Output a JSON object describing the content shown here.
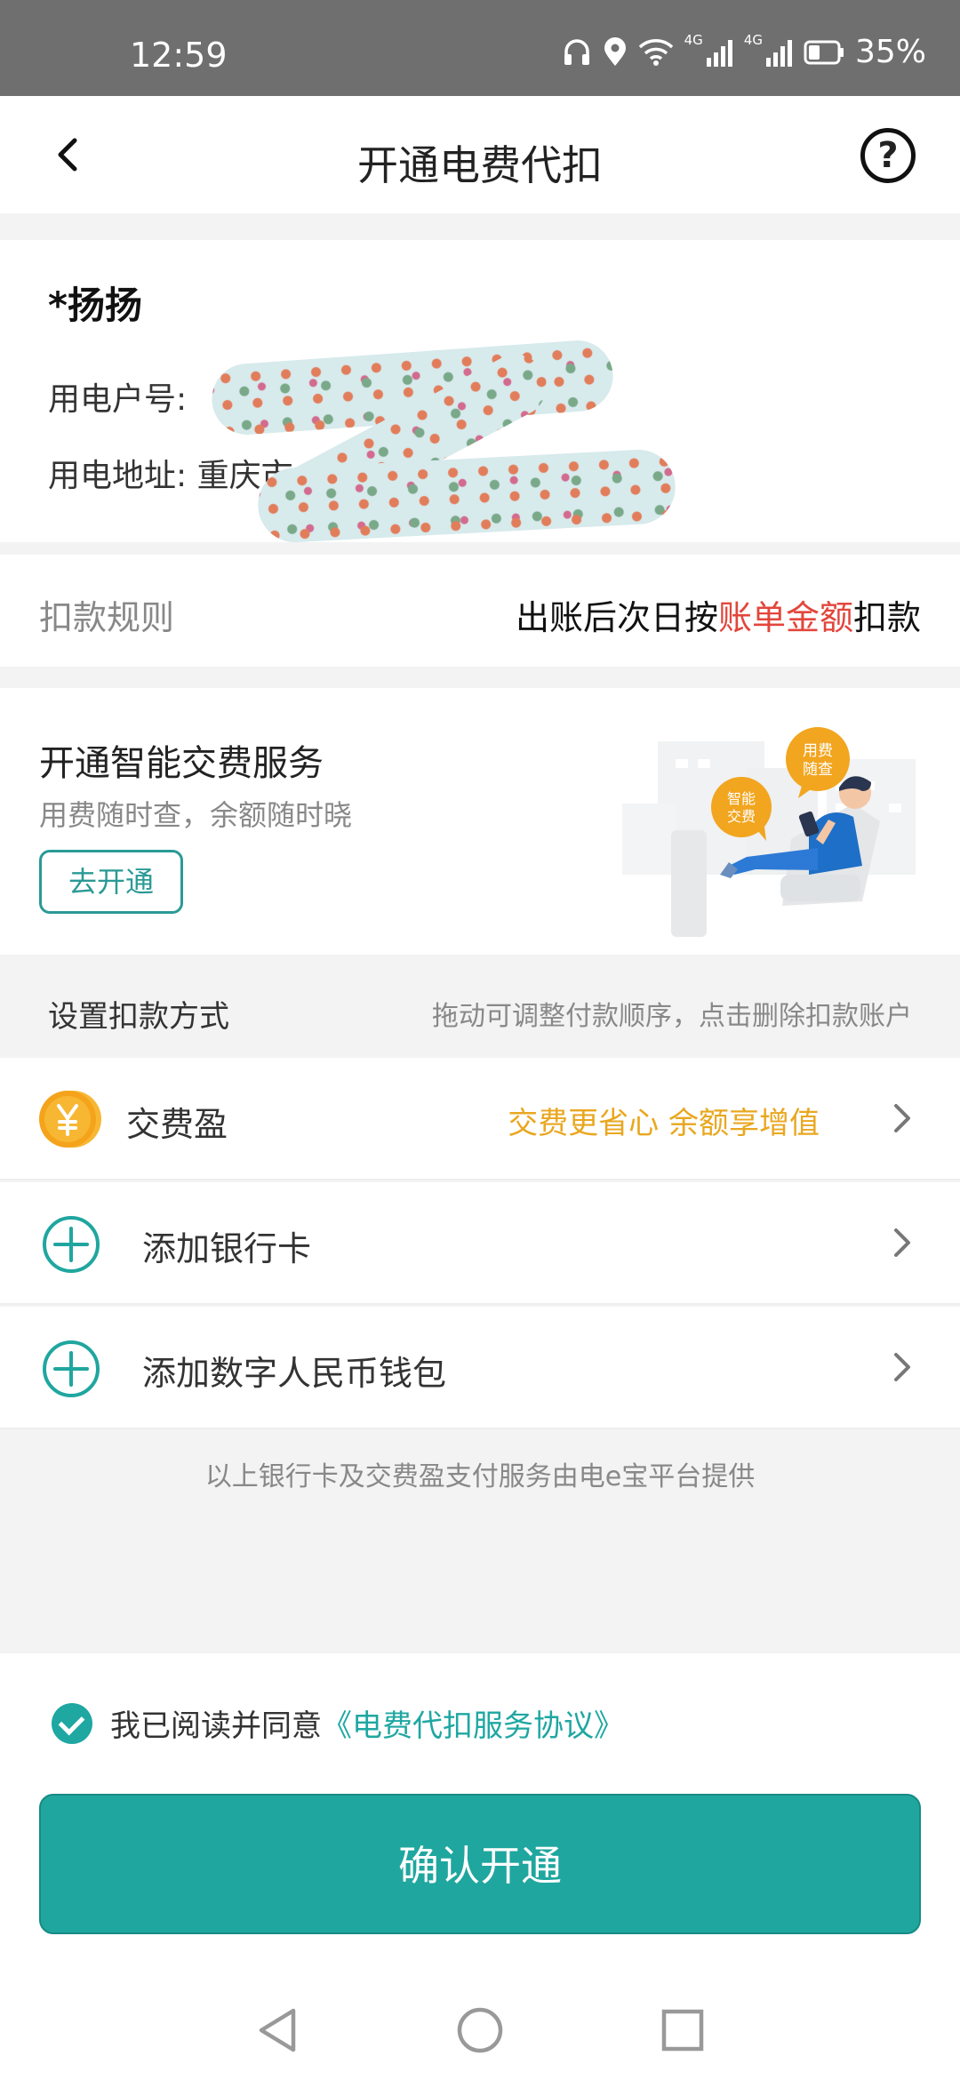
{
  "status_bar": {
    "time": "12:59",
    "network_badge": "4G",
    "battery": "35%"
  },
  "header": {
    "title": "开通电费代扣",
    "help_glyph": "?"
  },
  "account": {
    "name": "*扬扬",
    "number_label": "用电户号:",
    "address_label": "用电地址:",
    "address_partial": "重庆市"
  },
  "rule": {
    "label": "扣款规则",
    "value_prefix": "出账后次日按",
    "value_highlight": "账单金额",
    "value_suffix": "扣款"
  },
  "smart_service": {
    "title": "开通智能交费服务",
    "subtitle": "用费随时查，余额随时晓",
    "button": "去开通",
    "bubble_1_line1": "用费",
    "bubble_1_line2": "随查",
    "bubble_2_line1": "智能",
    "bubble_2_line2": "交费"
  },
  "payment": {
    "title": "设置扣款方式",
    "hint": "拖动可调整付款顺序，点击删除扣款账户",
    "methods": [
      {
        "label": "交费盈",
        "promo": "交费更省心 余额享增值",
        "icon": "yuan-coin-icon"
      },
      {
        "label": "添加银行卡",
        "icon": "plus-circle-icon"
      },
      {
        "label": "添加数字人民币钱包",
        "icon": "plus-circle-icon"
      }
    ],
    "provider_note": "以上银行卡及交费盈支付服务由电e宝平台提供"
  },
  "agreement": {
    "text": "我已阅读并同意",
    "link": "《电费代扣服务协议》"
  },
  "confirm_button": "确认开通",
  "colors": {
    "accent": "#1fa69f",
    "highlight_red": "#e2463c",
    "promo_gold": "#e9a71f"
  }
}
